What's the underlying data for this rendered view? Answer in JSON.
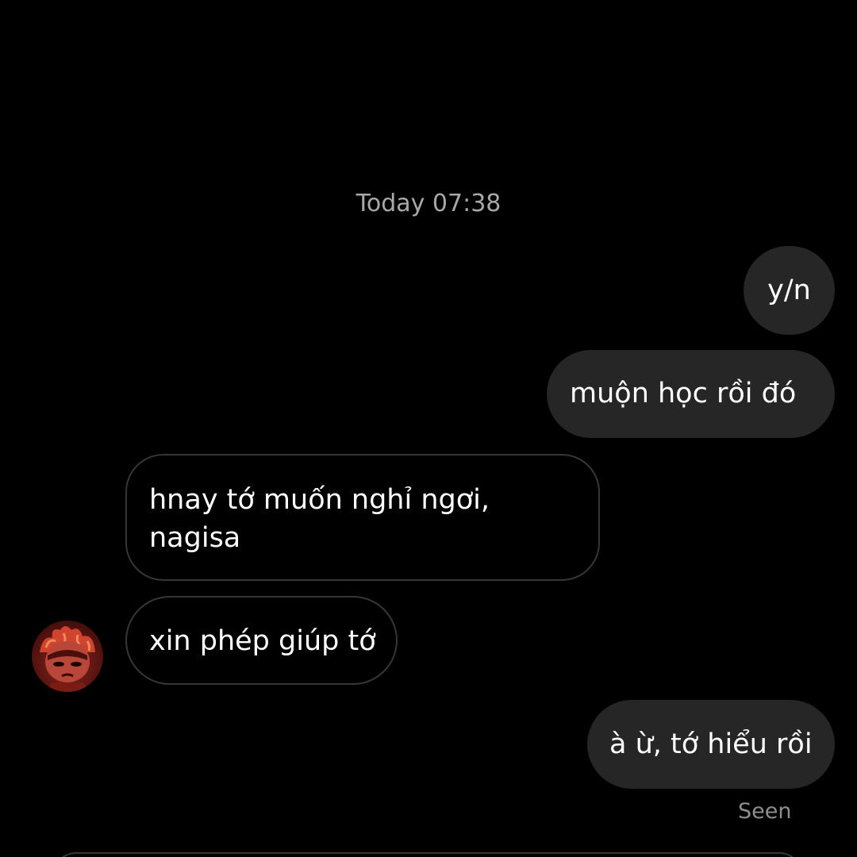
{
  "chat": {
    "timestamp": "Today 07:38",
    "messages": [
      {
        "direction": "outgoing",
        "text": "y/n"
      },
      {
        "direction": "outgoing",
        "text": "muộn học rồi đó"
      },
      {
        "direction": "incoming",
        "text": "hnay tớ muốn nghỉ ngơi, nagisa"
      },
      {
        "direction": "incoming",
        "text": "xin phép giúp tớ"
      },
      {
        "direction": "outgoing",
        "text": "à ừ, tớ hiểu rồi"
      }
    ],
    "read_receipt": "Seen"
  },
  "contact": {
    "avatar_icon": "profile-avatar"
  },
  "colors": {
    "background": "#000000",
    "outgoing_bubble": "#262626",
    "incoming_border": "#363636",
    "meta_text": "#a8a8a8"
  }
}
